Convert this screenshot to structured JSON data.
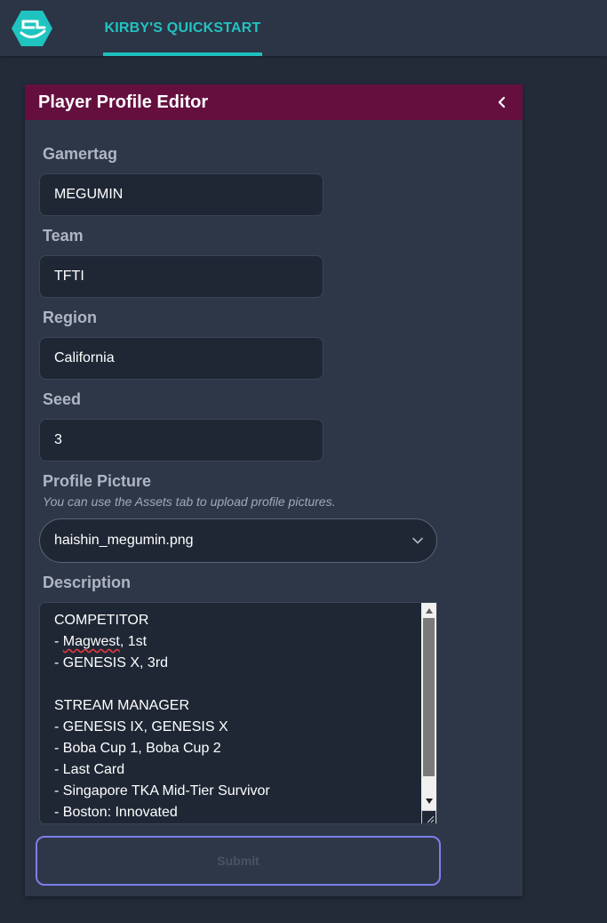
{
  "nav": {
    "logo_icon": "app-logo-icon",
    "tab_label": "KIRBY'S QUICKSTART",
    "accent": "#1fbfbd"
  },
  "panel": {
    "title": "Player Profile Editor",
    "collapse_icon": "chevron-left-icon",
    "header_color": "#650f3f"
  },
  "form": {
    "gamertag": {
      "label": "Gamertag",
      "value": "MEGUMIN"
    },
    "team": {
      "label": "Team",
      "value": "TFTI"
    },
    "region": {
      "label": "Region",
      "value": "California"
    },
    "seed": {
      "label": "Seed",
      "value": "3"
    },
    "profile_picture": {
      "label": "Profile Picture",
      "hint": "You can use the Assets tab to upload profile pictures.",
      "selected": "haishin_megumin.png"
    },
    "description": {
      "label": "Description",
      "lines": [
        "COMPETITOR",
        "- ",
        "Magwest",
        ", 1st",
        "- GENESIS X, 3rd",
        "",
        "STREAM MANAGER",
        "- GENESIS IX, GENESIS X",
        "- Boba Cup 1, Boba Cup 2",
        "- Last Card",
        "- Singapore TKA Mid-Tier Survivor",
        "- Boston: Innovated"
      ]
    },
    "submit_label": "Submit",
    "submit_border_color": "#7b7fe8"
  }
}
